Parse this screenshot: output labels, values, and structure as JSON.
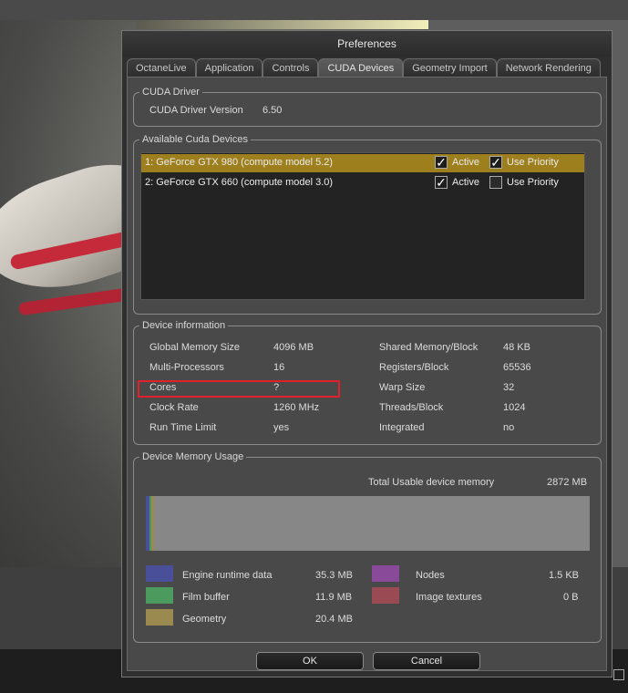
{
  "window": {
    "title": "Preferences"
  },
  "tabs": [
    {
      "label": "OctaneLive"
    },
    {
      "label": "Application"
    },
    {
      "label": "Controls"
    },
    {
      "label": "CUDA Devices"
    },
    {
      "label": "Geometry Import"
    },
    {
      "label": "Network Rendering"
    }
  ],
  "active_tab": "CUDA Devices",
  "cuda_driver": {
    "title": "CUDA Driver",
    "version_label": "CUDA Driver Version",
    "version_value": "6.50"
  },
  "available_devices": {
    "title": "Available Cuda Devices",
    "devices": [
      {
        "name": "1: GeForce GTX 980 (compute model 5.2)",
        "active_label": "Active",
        "active": true,
        "priority_label": "Use Priority",
        "priority": true,
        "selected": true
      },
      {
        "name": "2: GeForce GTX 660 (compute model 3.0)",
        "active_label": "Active",
        "active": true,
        "priority_label": "Use Priority",
        "priority": false,
        "selected": false
      }
    ]
  },
  "device_info": {
    "title": "Device information",
    "left": [
      {
        "label": "Global Memory Size",
        "value": "4096 MB"
      },
      {
        "label": "Multi-Processors",
        "value": "16"
      },
      {
        "label": "Cores",
        "value": "?"
      },
      {
        "label": "Clock Rate",
        "value": "1260 MHz"
      },
      {
        "label": "Run Time Limit",
        "value": "yes"
      }
    ],
    "right": [
      {
        "label": "Shared Memory/Block",
        "value": "48 KB"
      },
      {
        "label": "Registers/Block",
        "value": "65536"
      },
      {
        "label": "Warp Size",
        "value": "32"
      },
      {
        "label": "Threads/Block",
        "value": "1024"
      },
      {
        "label": "Integrated",
        "value": "no"
      }
    ]
  },
  "memory_usage": {
    "title": "Device Memory Usage",
    "total_label": "Total Usable device memory",
    "total_value": "2872 MB",
    "legend": [
      {
        "label": "Engine runtime data",
        "value": "35.3 MB",
        "color": "#4a4f9a"
      },
      {
        "label": "Film buffer",
        "value": "11.9 MB",
        "color": "#4c9a5e"
      },
      {
        "label": "Geometry",
        "value": "20.4 MB",
        "color": "#9a8a50"
      },
      {
        "label": "Nodes",
        "value": "1.5 KB",
        "color": "#8a4a9a"
      },
      {
        "label": "Image textures",
        "value": "0 B",
        "color": "#9a4a52"
      }
    ]
  },
  "buttons": {
    "ok": "OK",
    "cancel": "Cancel"
  },
  "colors": {
    "selection": "#9d7f1e",
    "highlight_box": "#e0202a"
  }
}
